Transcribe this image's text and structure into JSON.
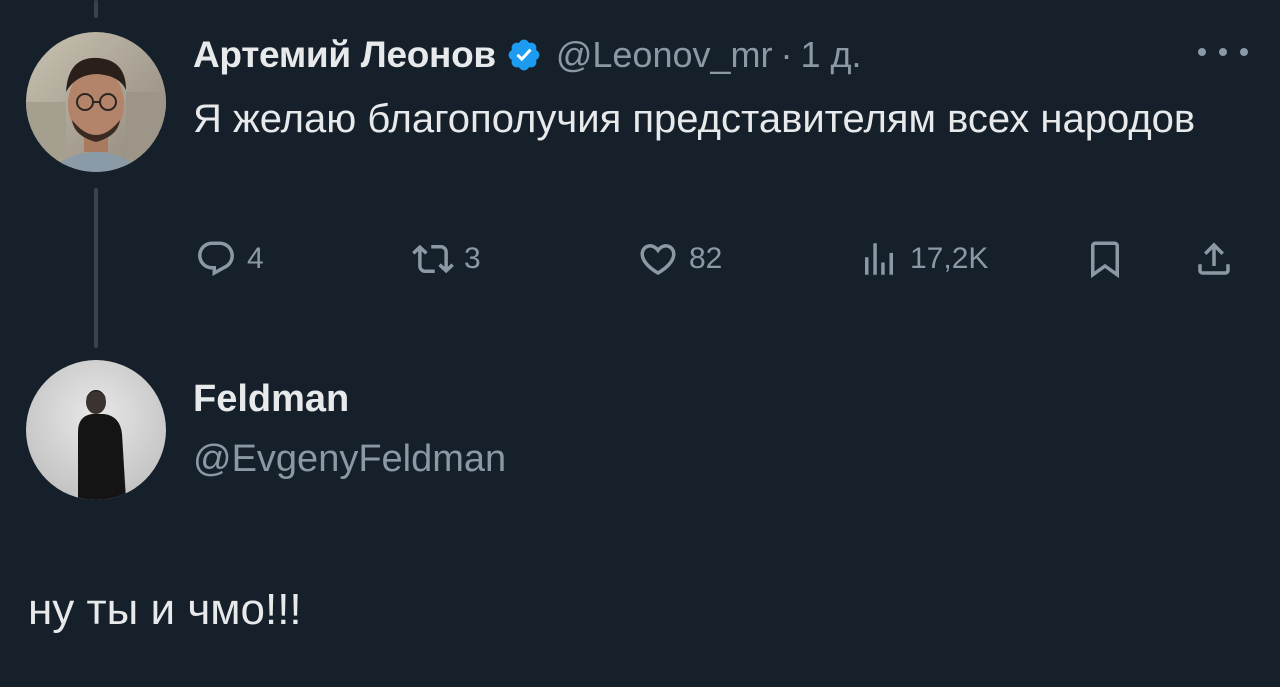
{
  "original_tweet": {
    "author_name": "Артемий Леонов",
    "handle": "@Leonov_mr",
    "separator": "·",
    "time": "1 д.",
    "text": "Я желаю благополучия представителям всех народов",
    "verified": true,
    "stats": {
      "replies": "4",
      "retweets": "3",
      "likes": "82",
      "views": "17,2K"
    }
  },
  "reply_tweet": {
    "author_name": "Feldman",
    "handle": "@EvgenyFeldman",
    "text": "ну ты и чмо!!!"
  },
  "icons": {
    "verified": "verified-badge-icon",
    "more": "more-icon",
    "reply": "reply-icon",
    "retweet": "retweet-icon",
    "like": "heart-icon",
    "views": "views-icon",
    "bookmark": "bookmark-icon",
    "share": "share-icon"
  },
  "colors": {
    "background": "#15202b",
    "text": "#e7e9ea",
    "muted": "#8b98a5",
    "verified": "#1d9bf0",
    "thread_line": "#38444d"
  }
}
